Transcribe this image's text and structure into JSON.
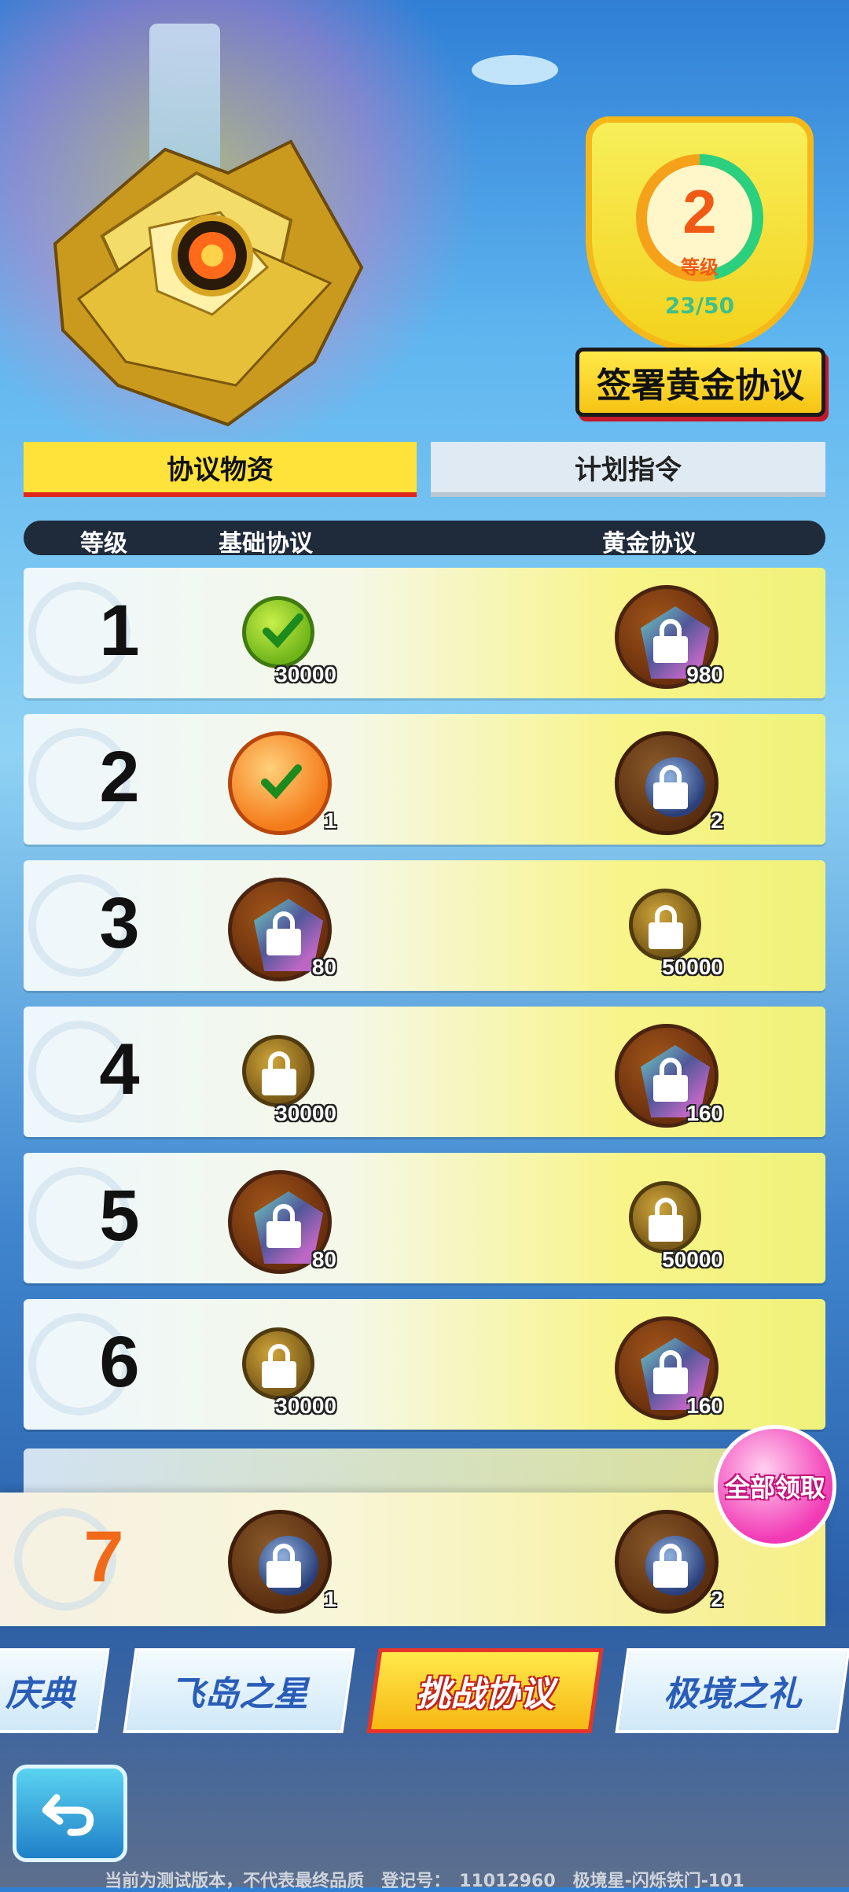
{
  "badge": {
    "level": "2",
    "level_label": "等级",
    "progress": "23/50",
    "progress_fraction": 0.46,
    "sign_button": "签署黄金协议"
  },
  "tabs": [
    {
      "label": "协议物资",
      "active": true
    },
    {
      "label": "计划指令",
      "active": false
    }
  ],
  "header": {
    "level": "等级",
    "basic": "基础协议",
    "gold": "黄金协议"
  },
  "rows": [
    {
      "level": "1",
      "basic": {
        "icon": "check-icon",
        "amount": "30000"
      },
      "gold": {
        "icon": "lock-icon",
        "amount": "980"
      }
    },
    {
      "level": "2",
      "basic": {
        "icon": "check-icon",
        "amount": "1"
      },
      "gold": {
        "icon": "lock-icon",
        "amount": "2"
      }
    },
    {
      "level": "3",
      "basic": {
        "icon": "lock-icon",
        "amount": "80"
      },
      "gold": {
        "icon": "lock-icon",
        "amount": "50000"
      }
    },
    {
      "level": "4",
      "basic": {
        "icon": "lock-icon",
        "amount": "30000"
      },
      "gold": {
        "icon": "lock-icon",
        "amount": "160"
      }
    },
    {
      "level": "5",
      "basic": {
        "icon": "lock-icon",
        "amount": "80"
      },
      "gold": {
        "icon": "lock-icon",
        "amount": "50000"
      }
    },
    {
      "level": "6",
      "basic": {
        "icon": "lock-icon",
        "amount": "30000"
      },
      "gold": {
        "icon": "lock-icon",
        "amount": "160"
      }
    }
  ],
  "sticky_row": {
    "level": "7",
    "basic_amount": "1",
    "gold_amount": "2"
  },
  "claim_all": "全部领取",
  "nav": [
    "庆典",
    "飞岛之星",
    "挑战协议",
    "极境之礼"
  ],
  "nav_active": "挑战协议",
  "footer": "当前为测试版本，不代表最终品质　登记号：　11012960　极境星-闪烁铁门-101",
  "colors": {
    "accent_yellow": "#ffe23a",
    "accent_red": "#e1261c",
    "level_orange": "#f05a14",
    "progress_green": "#3fbf8a"
  }
}
